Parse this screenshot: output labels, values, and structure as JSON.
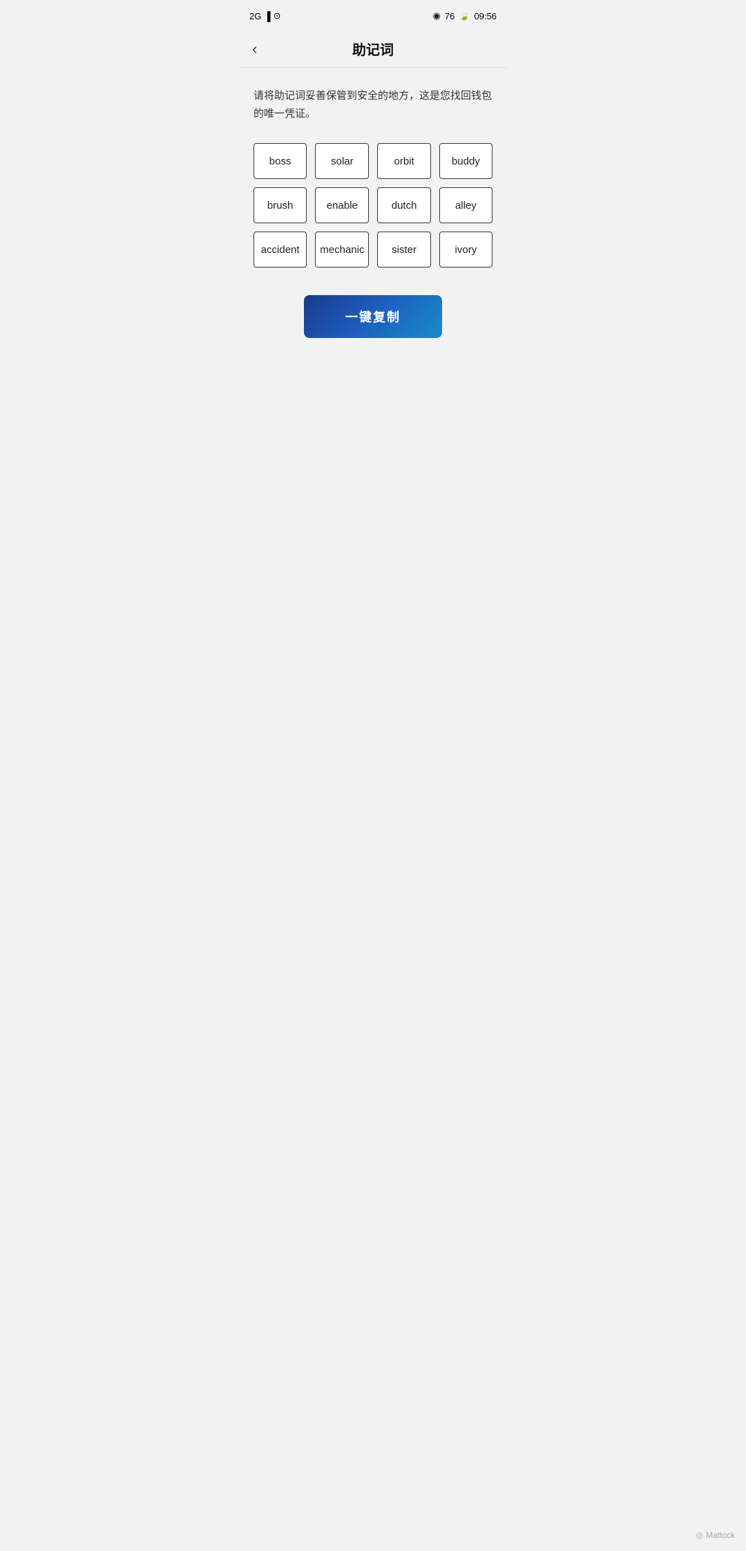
{
  "statusBar": {
    "signal": "2G",
    "battery": "76",
    "time": "09:56"
  },
  "header": {
    "backLabel": "‹",
    "title": "助记词"
  },
  "description": "请将助记词妥善保管到安全的地方，这是您找回钱包的唯一凭证。",
  "words": [
    "boss",
    "solar",
    "orbit",
    "buddy",
    "brush",
    "enable",
    "dutch",
    "alley",
    "accident",
    "mechanic",
    "sister",
    "ivory"
  ],
  "copyButton": {
    "label": "一键复制"
  },
  "watermark": {
    "brand": "Mattock",
    "icon": "◎"
  }
}
